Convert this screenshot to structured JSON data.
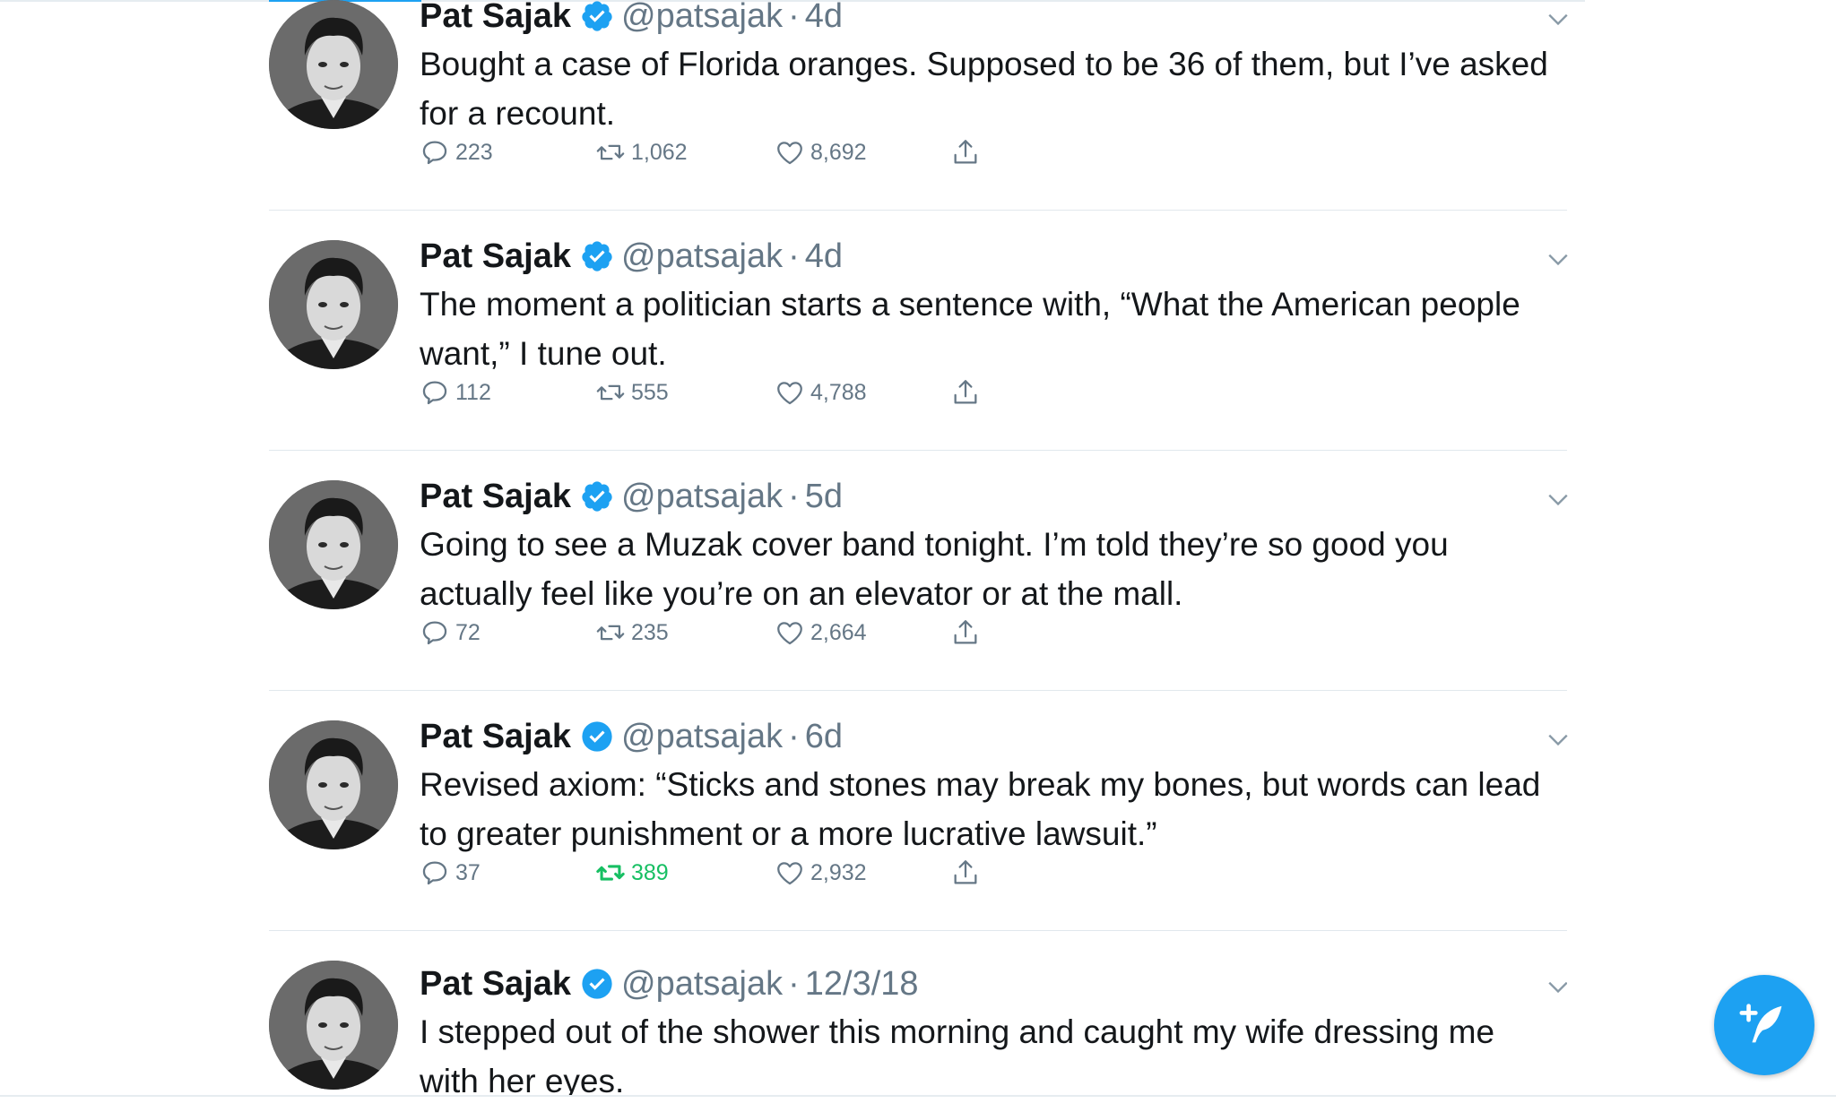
{
  "colors": {
    "accent": "#1da1f2",
    "retweet_active": "#17bf63",
    "secondary_text": "#657786",
    "primary_text": "#14171a"
  },
  "tweets": [
    {
      "name": "Pat Sajak",
      "handle": "@patsajak",
      "dot": "·",
      "time": "4d",
      "text": "Bought a case of Florida oranges. Supposed to be 36 of them, but I’ve asked for a recount.",
      "replies": "223",
      "retweets": "1,062",
      "likes": "8,692",
      "retweeted": false
    },
    {
      "name": "Pat Sajak",
      "handle": "@patsajak",
      "dot": "·",
      "time": "4d",
      "text": "The moment a politician starts a sentence with, “What the American people want,” I tune out.",
      "replies": "112",
      "retweets": "555",
      "likes": "4,788",
      "retweeted": false
    },
    {
      "name": "Pat Sajak",
      "handle": "@patsajak",
      "dot": "·",
      "time": "5d",
      "text": "Going to see a Muzak cover band tonight. I’m told they’re so good you actually feel like you’re on an elevator or at the mall.",
      "replies": "72",
      "retweets": "235",
      "likes": "2,664",
      "retweeted": false
    },
    {
      "name": "Pat Sajak",
      "handle": "@patsajak",
      "dot": "·",
      "time": "6d",
      "text": "Revised axiom: “Sticks and stones may break my bones, but words can lead to greater punishment or a more lucrative lawsuit.”",
      "replies": "37",
      "retweets": "389",
      "likes": "2,932",
      "retweeted": true
    },
    {
      "name": "Pat Sajak",
      "handle": "@patsajak",
      "dot": "·",
      "time": "12/3/18",
      "text": "I stepped out of the shower this morning and caught my wife dressing me with her eyes.",
      "replies": "",
      "retweets": "",
      "likes": "",
      "retweeted": false
    }
  ],
  "icons": {
    "verified": "verified-badge-icon",
    "caret": "chevron-down-icon",
    "reply": "reply-bubble-icon",
    "retweet": "retweet-icon",
    "like": "heart-icon",
    "share": "share-upload-icon",
    "compose": "compose-tweet-icon"
  }
}
